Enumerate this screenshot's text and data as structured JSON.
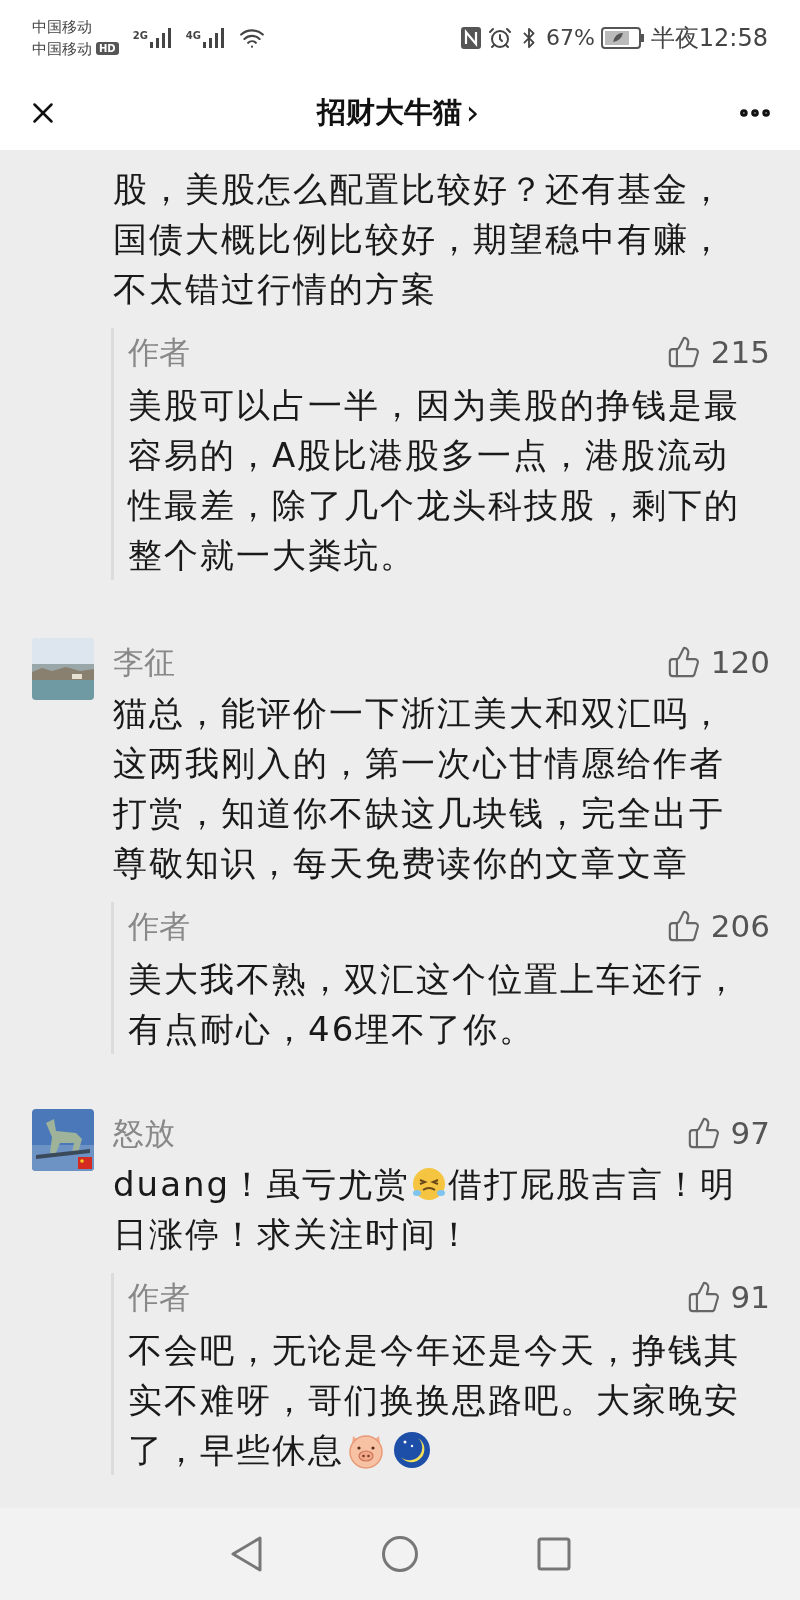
{
  "status_bar": {
    "carriers": [
      "中国移动",
      "中国移动"
    ],
    "hd_badge": "HD",
    "network_1": "2G",
    "network_2": "4G",
    "battery_percent": "67%",
    "time": "半夜12:58"
  },
  "header": {
    "title": "招财大牛猫",
    "chevron": "›"
  },
  "comments": [
    {
      "body": [
        {
          "kind": "text",
          "text": "股，美股怎么配置比较好？还有基金，国债大概比例比较好，期望稳中有赚，不太错过行情的方案"
        }
      ],
      "reply": {
        "author": "作者",
        "likes": "215",
        "body": [
          {
            "kind": "text",
            "text": "美股可以占一半，因为美股的挣钱是最容易的，A股比港股多一点，港股流动性最差，除了几个龙头科技股，剩下的整个就一大粪坑。"
          }
        ]
      }
    },
    {
      "avatar": {
        "kind": "picture"
      },
      "name": "李征",
      "likes": "120",
      "body": [
        {
          "kind": "text",
          "text": "猫总，能评价一下浙江美大和双汇吗，这两我刚入的，第一次心甘情愿给作者打赏，知道你不缺这几块钱，完全出于尊敬知识，每天免费读你的文章文章"
        }
      ],
      "reply": {
        "author": "作者",
        "likes": "206",
        "body": [
          {
            "kind": "text",
            "text": "美大我不熟，双汇这个位置上车还行，有点耐心，46埋不了你。"
          }
        ]
      }
    },
    {
      "avatar": {
        "kind": "picture"
      },
      "name": "怒放",
      "likes": "97",
      "body": [
        {
          "kind": "text",
          "text": "duang！虽亏尤赏"
        },
        {
          "kind": "laugh_cry"
        },
        {
          "kind": "text",
          "text": "借打屁股吉言！明"
        },
        {
          "kind": "text",
          "text": "日涨停！求关注时间！"
        }
      ],
      "reply": {
        "author": "作者",
        "likes": "91",
        "body": [
          {
            "kind": "text",
            "text": "不会吧，无论是今年还是今天，挣钱其实不难呀，哥们换换思路吧。大家晚安"
          },
          {
            "kind": "text",
            "text": "了，早些休息"
          },
          {
            "kind": "pig"
          },
          {
            "kind": "moon"
          }
        ]
      }
    }
  ]
}
